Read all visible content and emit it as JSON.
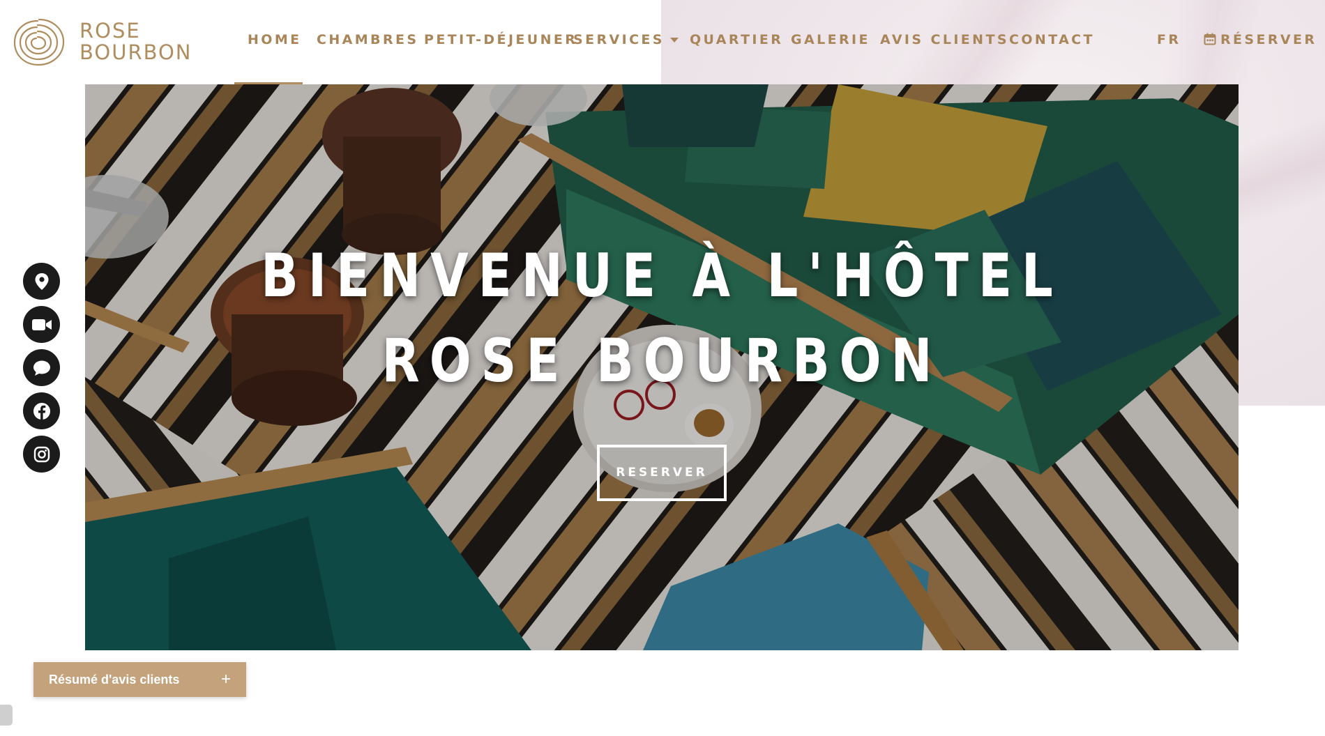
{
  "brand": {
    "line1": "ROSE",
    "line2": "BOURBON",
    "color": "#b08d5e"
  },
  "nav": {
    "items": [
      {
        "label": "HOME",
        "active": true
      },
      {
        "label": "CHAMBRES"
      },
      {
        "label": "PETIT-DÉJEUNER"
      },
      {
        "label": "SERVICES",
        "dropdown": true
      },
      {
        "label": "QUARTIER"
      },
      {
        "label": "GALERIE"
      },
      {
        "label": "AVIS CLIENTS"
      },
      {
        "label": "CONTACT"
      }
    ],
    "language": "FR",
    "reserve": "RÉSERVER",
    "reserve_icon": "calendar-icon"
  },
  "hero": {
    "title_line1": "BIENVENUE À L'HÔTEL",
    "title_line2": "ROSE BOURBON",
    "button": "RESERVER"
  },
  "social": [
    {
      "name": "location-pin-icon"
    },
    {
      "name": "video-camera-icon"
    },
    {
      "name": "chat-bubble-icon"
    },
    {
      "name": "facebook-icon"
    },
    {
      "name": "instagram-icon"
    }
  ],
  "review_widget": {
    "label": "Résumé d'avis clients",
    "toggle": "+"
  }
}
